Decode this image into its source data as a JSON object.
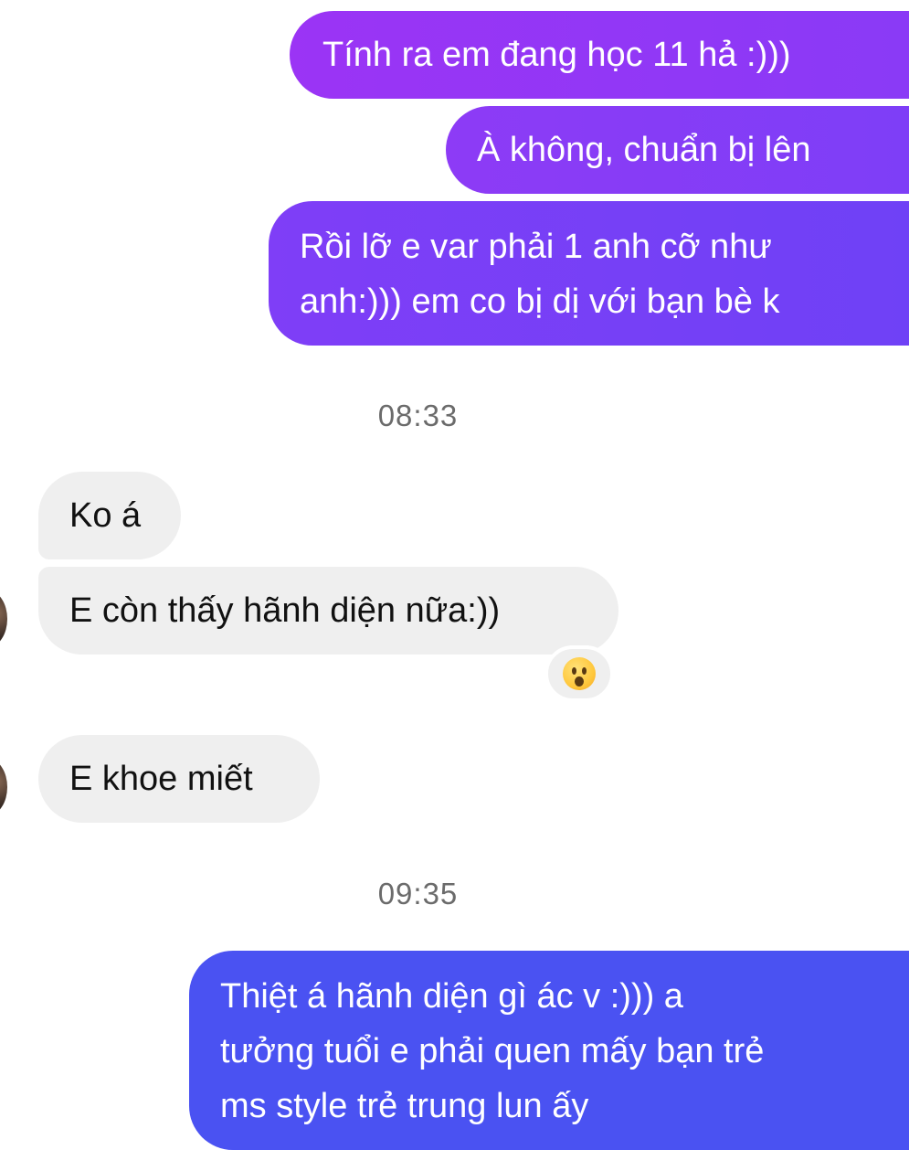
{
  "messages": {
    "out1": "Tính ra em đang học 11 hả :)))",
    "out2": "À không, chuẩn bị lên",
    "out3": "Rồi lỡ e var phải 1 anh cỡ như\nanh:))) em co bị dị với bạn bè k",
    "in1": "Ko á",
    "in2": "E còn thấy hãnh diện nữa:))",
    "in3": "E khoe miết",
    "out4": "Thiệt á hãnh diện gì ác v :))) a\ntưởng tuổi e phải quen mấy bạn trẻ\nms style trẻ trung lun ấy"
  },
  "timestamps": {
    "t1": "08:33",
    "t2": "09:35"
  },
  "reaction": {
    "icon": "surprised-face-emoji-icon"
  },
  "colors": {
    "outgoing_purple_start": "#9b36f5",
    "outgoing_purple_end": "#7a3cf7",
    "outgoing_blue": "#4a52f2",
    "incoming_bg": "#efefef",
    "timestamp_text": "#6b6b6b"
  }
}
